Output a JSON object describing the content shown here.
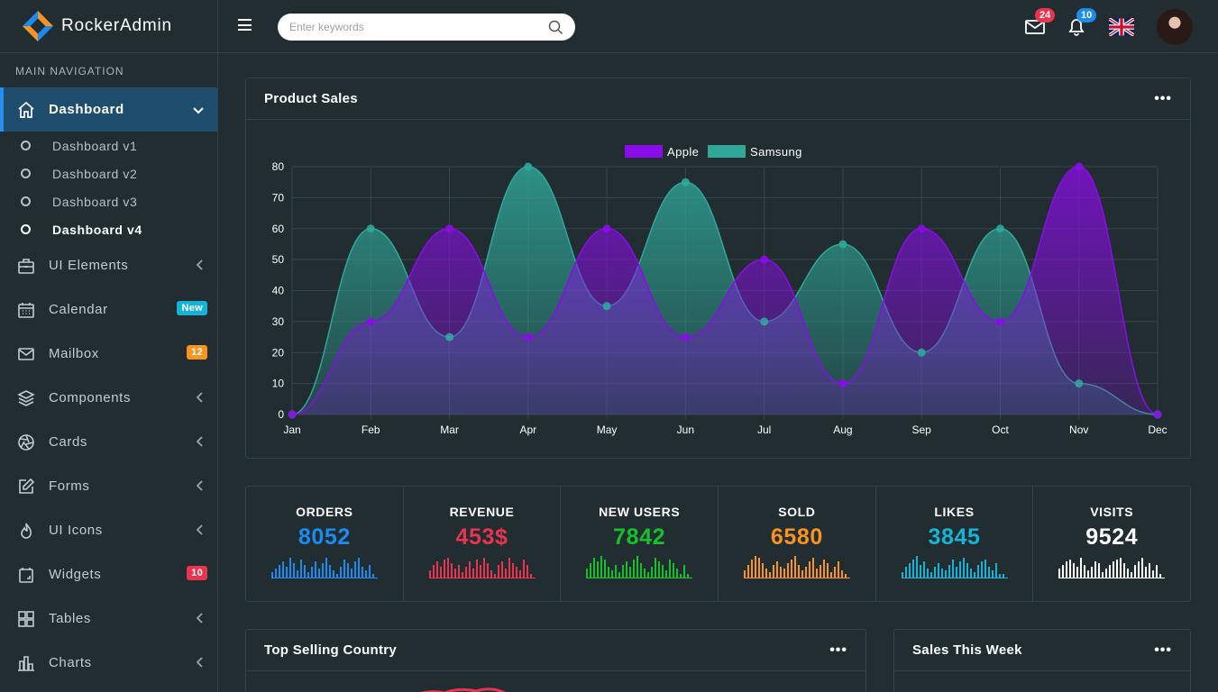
{
  "app": {
    "title": "RockerAdmin"
  },
  "sidebar": {
    "heading": "MAIN NAVIGATION",
    "dashboard": {
      "label": "Dashboard"
    },
    "sub_items": [
      "Dashboard v1",
      "Dashboard v2",
      "Dashboard v3",
      "Dashboard v4"
    ],
    "items": [
      {
        "label": "UI Elements",
        "icon": "briefcase-icon"
      },
      {
        "label": "Calendar",
        "icon": "calendar-icon",
        "badge": "New",
        "badge_color": "#17b3d6"
      },
      {
        "label": "Mailbox",
        "icon": "mail-icon",
        "badge": "12",
        "badge_color": "#f7931e"
      },
      {
        "label": "Components",
        "icon": "layers-icon"
      },
      {
        "label": "Cards",
        "icon": "aperture-icon"
      },
      {
        "label": "Forms",
        "icon": "edit-icon"
      },
      {
        "label": "UI Icons",
        "icon": "fire-icon"
      },
      {
        "label": "Widgets",
        "icon": "widget-icon",
        "badge": "10",
        "badge_color": "#e8344e"
      },
      {
        "label": "Tables",
        "icon": "grid-icon"
      },
      {
        "label": "Charts",
        "icon": "bar-chart-icon"
      }
    ]
  },
  "topbar": {
    "search_placeholder": "Enter keywords",
    "mail_count": "24",
    "notification_count": "10",
    "mail_badge_color": "#e8344e",
    "notification_badge_color": "#1a8cf0"
  },
  "product_sales": {
    "title": "Product Sales",
    "more": "•••"
  },
  "chart_data": {
    "type": "area",
    "categories": [
      "Jan",
      "Feb",
      "Mar",
      "Apr",
      "May",
      "Jun",
      "Jul",
      "Aug",
      "Sep",
      "Oct",
      "Nov",
      "Dec"
    ],
    "series": [
      {
        "name": "Apple",
        "color": "#8a0ce8",
        "values": [
          0,
          30,
          60,
          25,
          60,
          25,
          50,
          10,
          60,
          30,
          80,
          0
        ]
      },
      {
        "name": "Samsung",
        "color": "#2fa89a",
        "values": [
          0,
          60,
          25,
          80,
          35,
          75,
          30,
          55,
          20,
          60,
          10,
          0
        ]
      }
    ],
    "ylim": [
      0,
      80
    ],
    "yticks": [
      0,
      10,
      20,
      30,
      40,
      50,
      60,
      70,
      80
    ],
    "grid": true,
    "legend": "top-center"
  },
  "stats": [
    {
      "label": "ORDERS",
      "value": "8052",
      "color": "#1a8cf0"
    },
    {
      "label": "REVENUE",
      "value": "453$",
      "color": "#e8344e"
    },
    {
      "label": "NEW USERS",
      "value": "7842",
      "color": "#16c02a"
    },
    {
      "label": "SOLD",
      "value": "6580",
      "color": "#f7931e"
    },
    {
      "label": "LIKES",
      "value": "3845",
      "color": "#17b3d6"
    },
    {
      "label": "VISITS",
      "value": "9524",
      "color": "#ffffff"
    }
  ],
  "top_selling": {
    "title": "Top Selling Country",
    "more": "•••"
  },
  "sales_week": {
    "title": "Sales This Week",
    "more": "•••"
  }
}
